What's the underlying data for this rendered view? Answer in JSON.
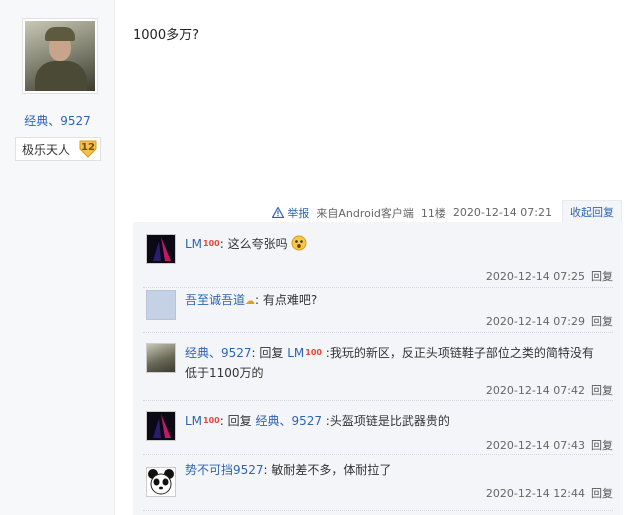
{
  "user": {
    "avatar_icon": "soldier-avatar",
    "name": "经典、9527",
    "level_name": "极乐天人",
    "level_number": "12"
  },
  "post": {
    "content": "1000多万?",
    "report_label": "举报",
    "source": "来自Android客户端",
    "floor": "11楼",
    "timestamp": "2020-12-14 07:21",
    "collapse_reply_label": "收起回复"
  },
  "replies": [
    {
      "avatar_icon": "dark-abstract-avatar",
      "user": "LM",
      "user_mark": "💯",
      "text": ": 这么夸张吗",
      "emoji": "surprised-emoji",
      "time": "2020-12-14 07:25",
      "reply_label": "回复"
    },
    {
      "avatar_icon": "default-blank-avatar",
      "user": "吾至诚吾道",
      "user_mark": "☁",
      "text": ": 有点难吧?",
      "time": "2020-12-14 07:29",
      "reply_label": "回复"
    },
    {
      "avatar_icon": "soldier-avatar",
      "user": "经典、9527",
      "reply_prefix": ": 回复 ",
      "reply_to": "LM",
      "reply_to_mark": "💯",
      "text": " :我玩的新区，反正头项链鞋子部位之类的简特没有低于1100万的",
      "time": "2020-12-14 07:42",
      "reply_label": "回复"
    },
    {
      "avatar_icon": "dark-abstract-avatar",
      "user": "LM",
      "user_mark": "💯",
      "reply_prefix": ": 回复 ",
      "reply_to": "经典、9527",
      "text": " :头盔项链是比武器贵的",
      "time": "2020-12-14 07:43",
      "reply_label": "回复"
    },
    {
      "avatar_icon": "panda-avatar",
      "user": "势不可挡9527",
      "text": ": 敏耐差不多，体耐拉了",
      "time": "2020-12-14 12:44",
      "reply_label": "回复"
    }
  ],
  "colors": {
    "link_blue": "#2d64b3",
    "sub_bg": "#f3f5f8",
    "panel_bg": "#f7f8fa",
    "level_badge": "#f3c24a"
  }
}
